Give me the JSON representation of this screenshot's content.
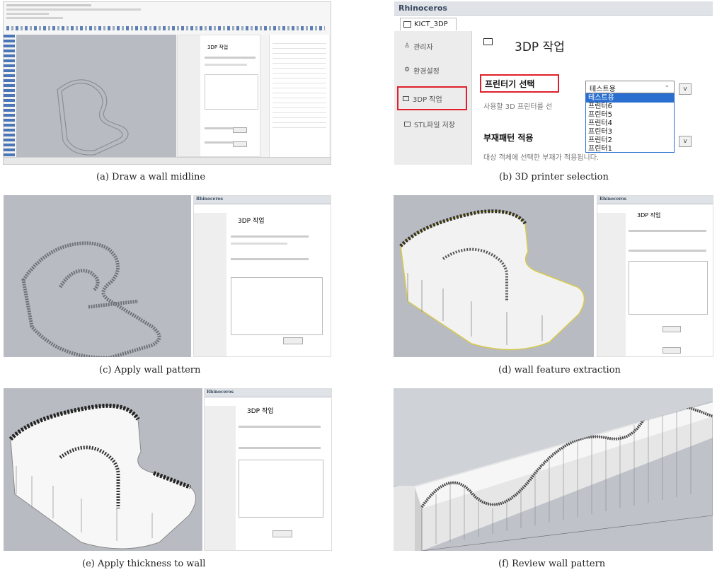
{
  "captions": {
    "a": "(a) Draw a wall midline",
    "b": "(b) 3D printer selection",
    "c": "(c) Apply wall pattern",
    "d": "(d) wall feature extraction",
    "e": "(e) Apply thickness to wall",
    "f": "(f) Review wall pattern"
  },
  "app": {
    "title": "Rhinoceros",
    "tab": "KICT_3DP",
    "sidebar": [
      "관리자",
      "환경설정",
      "3DP 작업",
      "STL파일 저장"
    ],
    "heading": "3DP 작업",
    "printer_label": "프린터기 선택",
    "printer_value": "테스트용",
    "printer_hint": "사용할 3D 프린터를 선",
    "printer_options": [
      "테스트용",
      "프린터6",
      "프린터5",
      "프린터4",
      "프린터3",
      "프린터2",
      "프린터1"
    ],
    "pattern_label": "부재패턴 적용",
    "pattern_hint": "대상 객체에 선택한 부재가 적용됩니다."
  },
  "colors": {
    "highlight": "#e0202a",
    "selection": "#2a6fd0",
    "viewport": "#b8bcc2"
  }
}
